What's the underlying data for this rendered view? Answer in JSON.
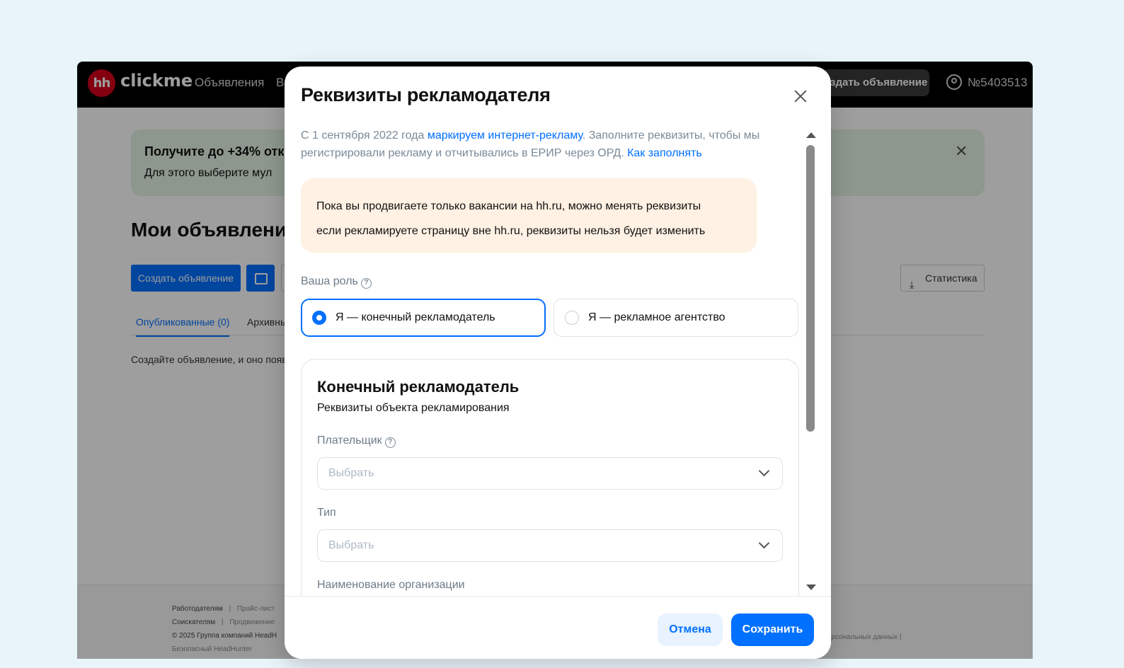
{
  "topbar": {
    "logo_mark": "hh",
    "logo_text": "clickme",
    "nav": [
      "Объявления",
      "В"
    ],
    "create_label": "здать объявление",
    "user_id": "№5403513"
  },
  "page": {
    "promo_title": "Получите до +34% отк",
    "promo_sub": "Для этого выберите мул",
    "promo_close": "✕",
    "title": "Мои объявления",
    "create_button": "Создать объявление",
    "stats_button": "Статистика",
    "stats_icon": "⤓",
    "tabs": [
      "Опубликованные (0)",
      "Архивны"
    ],
    "empty_text": "Создайте объявление, и оно появ"
  },
  "footer": {
    "line1": [
      "Работодателям",
      "|",
      "Прайс-лист"
    ],
    "line2": [
      "Соискателям",
      "|",
      "Продвижение"
    ],
    "line3": "© 2025 Группа компаний HeadH",
    "line4": "Безопасный HeadHunter",
    "right": "ерсональных данных   |"
  },
  "modal": {
    "title": "Реквизиты рекламодателя",
    "intro_1": "С 1 сентября 2022 года ",
    "intro_link1": "маркируем интернет-рекламу",
    "intro_2": ". Заполните реквизиты, чтобы мы регистрировали рекламу и отчитывались в ЕРИР через ОРД. ",
    "intro_link2": "Как заполнять",
    "info_line1": "Пока вы продвигаете только вакансии на hh.ru, можно менять реквизиты",
    "info_line2": "если рекламируете страницу вне hh.ru, реквизиты нельзя будет изменить",
    "role_label": "Ваша роль",
    "help_glyph": "?",
    "role_options": [
      {
        "label": "Я — конечный рекламодатель",
        "selected": true
      },
      {
        "label": "Я — рекламное агентство",
        "selected": false
      }
    ],
    "card_title": "Конечный рекламодатель",
    "card_sub": "Реквизиты объекта рекламирования",
    "payer_label": "Плательщик",
    "payer_placeholder": "Выбрать",
    "type_label": "Тип",
    "type_placeholder": "Выбрать",
    "org_label": "Наименование организации",
    "cancel": "Отмена",
    "save": "Сохранить"
  },
  "colors": {
    "accent": "#0070ff",
    "brand_red": "#d6001c",
    "info_bg": "#fff1e3",
    "promo_bg": "#e4f4e4"
  },
  "icons": [
    "close-icon",
    "help-icon",
    "chevron-down-icon",
    "user-icon",
    "download-icon"
  ]
}
